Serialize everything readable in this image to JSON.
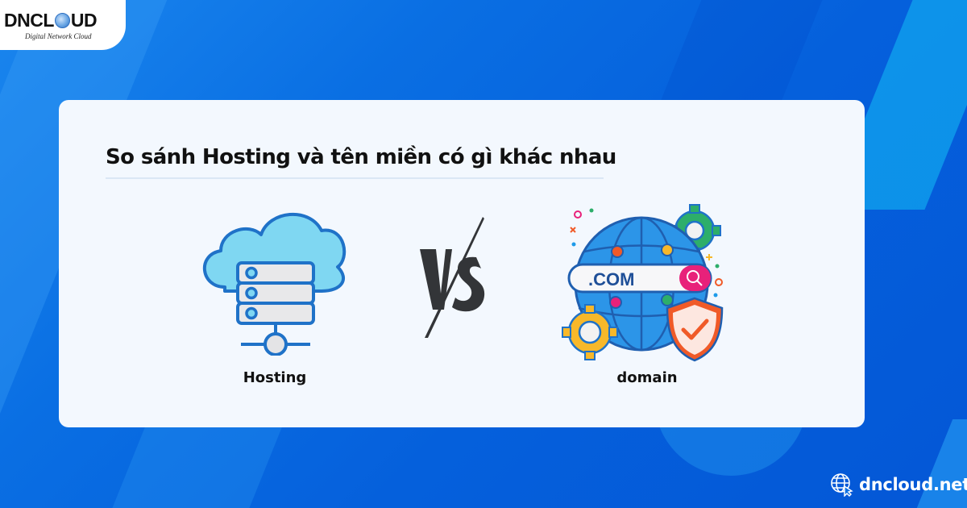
{
  "brand": {
    "logo_text_left": "DNCL",
    "logo_text_right": "UD",
    "logo_subtitle": "Digital Network Cloud",
    "website": "dncloud.net"
  },
  "card": {
    "title": "So sánh Hosting và tên miền có gì khác nhau",
    "left_item": {
      "label": "Hosting",
      "icon": "cloud-server-icon"
    },
    "versus": {
      "label": "VS",
      "icon": "versus-icon"
    },
    "right_item": {
      "label": "domain",
      "icon": "globe-domain-icon",
      "domain_text": ".COM"
    }
  },
  "colors": {
    "background_primary": "#0a6fe3",
    "card_bg": "#f3f8fe",
    "title_text": "#111111",
    "icon_blue": "#1f72c8",
    "cloud_fill": "#7fd7f2",
    "vs_dark": "#333538",
    "search_pink": "#e8217a",
    "shield_orange": "#f05a28",
    "gear_yellow": "#f7b82a",
    "gear_green": "#2dae6a"
  }
}
